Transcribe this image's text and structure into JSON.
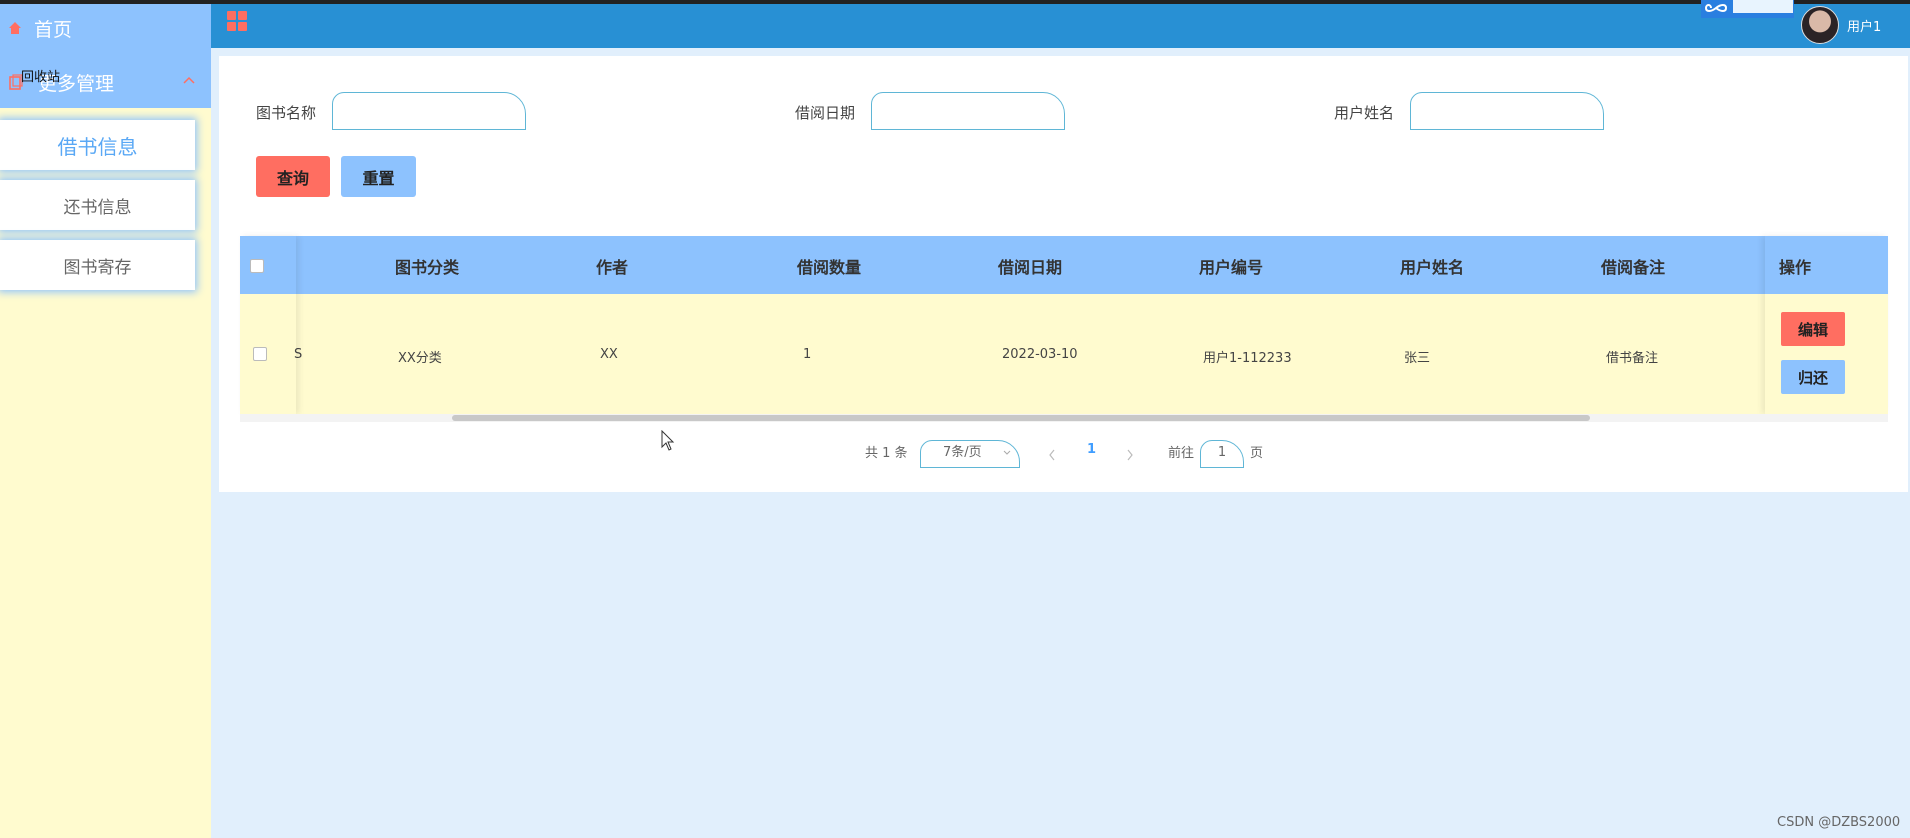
{
  "sidebar": {
    "home": "首页",
    "more": "更多管理",
    "overlay": "回收站",
    "items": [
      {
        "label": "借书信息",
        "active": true
      },
      {
        "label": "还书信息",
        "active": false
      },
      {
        "label": "图书寄存",
        "active": false
      }
    ]
  },
  "header": {
    "user": "用户1",
    "upload_badge_icon": "infinity-icon"
  },
  "filters": [
    {
      "label": "图书名称",
      "value": ""
    },
    {
      "label": "借阅日期",
      "value": ""
    },
    {
      "label": "用户姓名",
      "value": ""
    }
  ],
  "buttons": {
    "query": "查询",
    "reset": "重置"
  },
  "table": {
    "columns": [
      "图书分类",
      "作者",
      "借阅数量",
      "借阅日期",
      "用户编号",
      "用户姓名",
      "借阅备注",
      "操作"
    ],
    "rows": [
      {
        "partial": "S",
        "category": "XX分类",
        "author": "XX",
        "quantity": "1",
        "date": "2022-03-10",
        "user_id": "用户1-112233",
        "user_name": "张三",
        "remark": "借书备注",
        "edit": "编辑",
        "return": "归还"
      }
    ]
  },
  "pagination": {
    "total": "共 1 条",
    "page_size": "7条/页",
    "current": "1",
    "goto_prefix": "前往",
    "goto_value": "1",
    "goto_suffix": "页"
  },
  "watermark": "CSDN @DZBS2000",
  "colors": {
    "header": "#2890d4",
    "accent_blue": "#8dc2fe",
    "accent_red": "#ff6e61",
    "row_bg": "#fffbcf",
    "page_bg": "#e1effc"
  }
}
